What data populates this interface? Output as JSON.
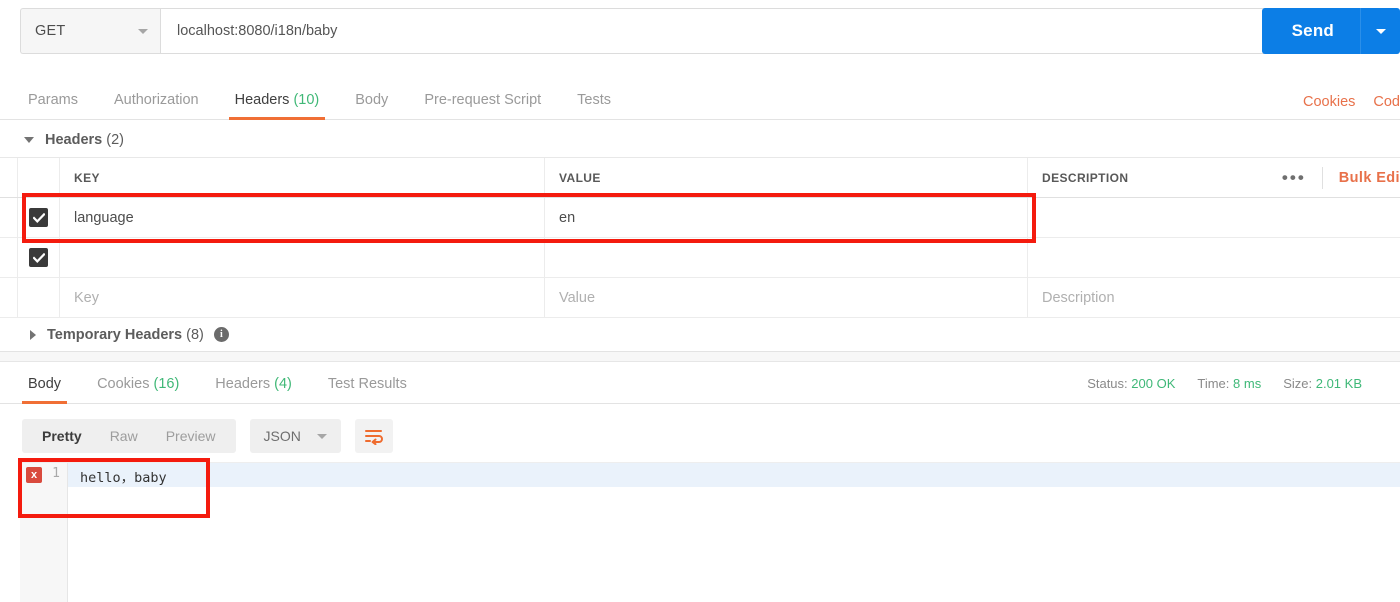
{
  "request": {
    "method": "GET",
    "url": "localhost:8080/i18n/baby",
    "send_label": "Send",
    "tabs": [
      {
        "label": "Params",
        "count": "",
        "active": false
      },
      {
        "label": "Authorization",
        "count": "",
        "active": false
      },
      {
        "label": "Headers",
        "count": "(10)",
        "active": true
      },
      {
        "label": "Body",
        "count": "",
        "active": false
      },
      {
        "label": "Pre-request Script",
        "count": "",
        "active": false
      },
      {
        "label": "Tests",
        "count": "",
        "active": false
      }
    ],
    "tabs_right": [
      {
        "label": "Cookies"
      },
      {
        "label": "Cod"
      }
    ]
  },
  "headers_section": {
    "title": "Headers",
    "count": "(2)",
    "columns": {
      "key": "KEY",
      "value": "VALUE",
      "description": "DESCRIPTION"
    },
    "dots": "•••",
    "bulk_edit": "Bulk Edi",
    "rows": [
      {
        "checked": true,
        "key": "language",
        "value": "en",
        "description": ""
      },
      {
        "checked": true,
        "key": "",
        "value": "",
        "description": ""
      }
    ],
    "placeholder_row": {
      "key": "Key",
      "value": "Value",
      "description": "Description"
    }
  },
  "temporary_headers": {
    "title": "Temporary Headers",
    "count": "(8)",
    "info_glyph": "i"
  },
  "response": {
    "tabs": [
      {
        "label": "Body",
        "count": "",
        "active": true
      },
      {
        "label": "Cookies",
        "count": "(16)",
        "active": false
      },
      {
        "label": "Headers",
        "count": "(4)",
        "active": false
      },
      {
        "label": "Test Results",
        "count": "",
        "active": false
      }
    ],
    "status_label": "Status:",
    "status_value": "200 OK",
    "time_label": "Time:",
    "time_value": "8 ms",
    "size_label": "Size:",
    "size_value": "2.01 KB",
    "view_modes": [
      {
        "label": "Pretty",
        "active": true
      },
      {
        "label": "Raw",
        "active": false
      },
      {
        "label": "Preview",
        "active": false
      }
    ],
    "format": "JSON",
    "body": {
      "line_number": "1",
      "error_glyph": "x",
      "text": "hello，baby"
    }
  },
  "colors": {
    "accent_orange": "#f06f35",
    "link_orange": "#e8714a",
    "send_blue": "#0c7ee6",
    "success_green": "#3fb878",
    "annotation_red": "#f41b0e"
  }
}
